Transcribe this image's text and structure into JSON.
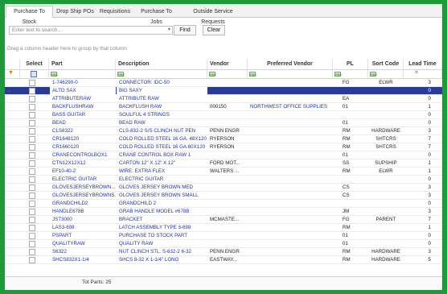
{
  "tabs": [
    {
      "label": "Purchase To Stock"
    },
    {
      "label": "Drop Ship POs"
    },
    {
      "label": "Requisitions"
    },
    {
      "label": "Purchase To Jobs"
    },
    {
      "label": "Outside Service Requests"
    }
  ],
  "search": {
    "placeholder": "Enter text to search...",
    "find_label": "Find",
    "clear_label": "Clear"
  },
  "group_hint": "Drag a column header here to group by that column",
  "columns": {
    "select": "Select",
    "part": "Part",
    "description": "Description",
    "vendor": "Vendor",
    "preferred_vendor": "Preferred Vendor",
    "pl": "PL",
    "sort_code": "Sort Code",
    "lead_time": "Lead Time"
  },
  "rows": [
    {
      "part": "1-746290-0",
      "description": "CONNECTOR: IDC-50",
      "vendor": "",
      "preferred_vendor": "",
      "pl": "FG",
      "sort_code": "ELWR",
      "lead_time": "3"
    },
    {
      "part": "ALTO SAX",
      "description": "BIG SAXY",
      "vendor": "",
      "preferred_vendor": "",
      "pl": "",
      "sort_code": "",
      "lead_time": "0",
      "selected": true
    },
    {
      "part": "ATTRIBUTERAW",
      "description": "ATTRIBUTE RAW",
      "vendor": "",
      "preferred_vendor": "",
      "pl": "EA",
      "sort_code": "",
      "lead_time": "0"
    },
    {
      "part": "BACKFLUSHRAW",
      "description": "BACKFLUSH RAW",
      "vendor": "000150",
      "preferred_vendor": "NORTHWEST OFFICE SUPPLIES",
      "pl": "01",
      "sort_code": "",
      "lead_time": "1"
    },
    {
      "part": "BASS GUITAR",
      "description": "SOULFUL 4 STRINGS",
      "vendor": "",
      "preferred_vendor": "",
      "pl": "",
      "sort_code": "",
      "lead_time": "0"
    },
    {
      "part": "BEAD",
      "description": "BEAD RAW",
      "vendor": "",
      "preferred_vendor": "",
      "pl": "01",
      "sort_code": "",
      "lead_time": "0"
    },
    {
      "part": "CLS8322",
      "description": "CLS-832-2 S/S CLINCH NUT PEN",
      "vendor": "PENN ENGR",
      "preferred_vendor": "",
      "pl": "RM",
      "sort_code": "HARDWARE",
      "lead_time": "3"
    },
    {
      "part": "CR1648120",
      "description": "COLD ROLLED STEEL 16 GA. 48X120",
      "vendor": "RYERSON",
      "preferred_vendor": "",
      "pl": "RM",
      "sort_code": "SHTCRS",
      "lead_time": "7"
    },
    {
      "part": "CR1660120",
      "description": "COLD ROLLED STEEL 16 GA.60X120",
      "vendor": "RYERSON",
      "preferred_vendor": "",
      "pl": "RM",
      "sort_code": "SHTCRS",
      "lead_time": "7"
    },
    {
      "part": "CRANECONTROLBOX1",
      "description": "CRANE CONTROL BOX RAW 1",
      "vendor": "",
      "preferred_vendor": "",
      "pl": "01",
      "sort_code": "",
      "lead_time": "0"
    },
    {
      "part": "CTN12X12X12",
      "description": "CARTON 12\" X 12\" X 12\"",
      "vendor": "FORD MOT...",
      "preferred_vendor": "",
      "pl": "SS",
      "sort_code": "SUPSHIP",
      "lead_time": "1"
    },
    {
      "part": "EF10-40-2",
      "description": "WIRE: EXTRA FLEX",
      "vendor": "WALTERS ...",
      "preferred_vendor": "",
      "pl": "RM",
      "sort_code": "ELWR",
      "lead_time": "1"
    },
    {
      "part": "ELECTRIC GUITAR",
      "description": "ELECTRIC GUITAR",
      "vendor": "",
      "preferred_vendor": "",
      "pl": "",
      "sort_code": "",
      "lead_time": "0"
    },
    {
      "part": "GLOVESJERSEYBROWN...",
      "description": "GLOVES JERSEY BROWN MED",
      "vendor": "",
      "preferred_vendor": "",
      "pl": "CS",
      "sort_code": "",
      "lead_time": "3"
    },
    {
      "part": "GLOVESJERSEYBROWNS...",
      "description": "GLOVES JERSEY BROWN SMALL",
      "vendor": "",
      "preferred_vendor": "",
      "pl": "CS",
      "sort_code": "",
      "lead_time": "3"
    },
    {
      "part": "GRANDCHILD2",
      "description": "GRANDCHILD 2",
      "vendor": "",
      "preferred_vendor": "",
      "pl": "",
      "sort_code": "",
      "lead_time": "0"
    },
    {
      "part": "HANDLE678B",
      "description": "GRAB HANDLE MODEL #678B",
      "vendor": "",
      "preferred_vendor": "",
      "pl": "JM",
      "sort_code": "",
      "lead_time": "3"
    },
    {
      "part": "JST3000",
      "description": "BRACKET",
      "vendor": "MCMASTE...",
      "preferred_vendor": "",
      "pl": "FG",
      "sort_code": "PARENT",
      "lead_time": "7"
    },
    {
      "part": "LAS3-698",
      "description": "LATCH ASSEMBLY TYPE 3-698",
      "vendor": "",
      "preferred_vendor": "",
      "pl": "RM",
      "sort_code": "",
      "lead_time": "1"
    },
    {
      "part": "PSPART",
      "description": "PURCHASE TO STOCK PART",
      "vendor": "",
      "preferred_vendor": "",
      "pl": "01",
      "sort_code": "",
      "lead_time": "0"
    },
    {
      "part": "QUALITYRAW",
      "description": "QUALITY RAW",
      "vendor": "",
      "preferred_vendor": "",
      "pl": "01",
      "sort_code": "",
      "lead_time": "0"
    },
    {
      "part": "S6322",
      "description": "NUT CLINCH STL. S-632-2 6-32",
      "vendor": "PENN ENGR",
      "preferred_vendor": "",
      "pl": "RM",
      "sort_code": "HARDWARE",
      "lead_time": "3"
    },
    {
      "part": "SHCS832X1-1/4",
      "description": "SHCS 8-32 X 1-1/4\" LONG",
      "vendor": "EASTWAY...",
      "preferred_vendor": "",
      "pl": "RM",
      "sort_code": "HARDWARE",
      "lead_time": "5"
    }
  ],
  "footer": {
    "total_parts": "Tot Parts: 25"
  }
}
